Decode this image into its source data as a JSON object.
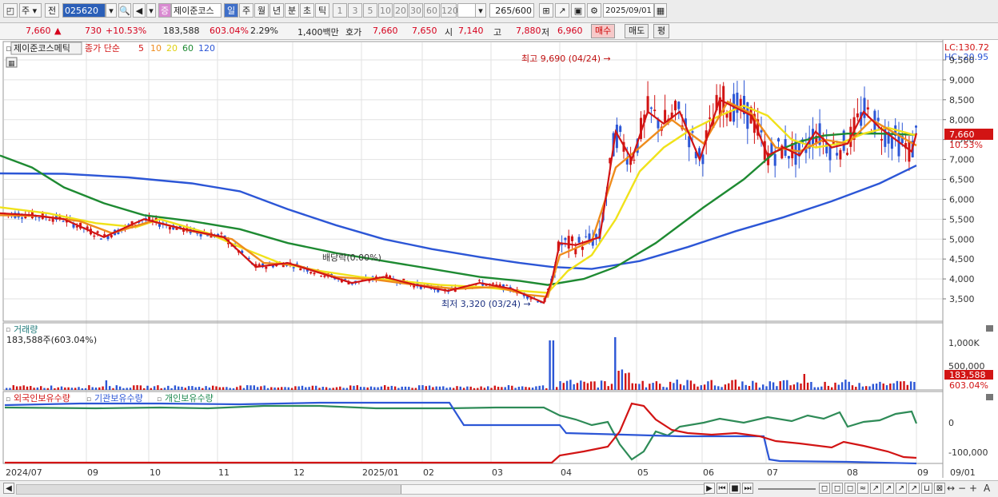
{
  "toolbar": {
    "type_label": "주",
    "jeon_label": "전",
    "code": "025620",
    "badge": "증",
    "stock_name": "제이준코스",
    "periods": [
      "일",
      "주",
      "월",
      "년",
      "분",
      "초",
      "틱"
    ],
    "active_period": "일",
    "minutes": [
      "1",
      "3",
      "5",
      "10",
      "20",
      "30",
      "60",
      "120"
    ],
    "count": "265",
    "count_total": "/600",
    "date": "2025/09/01"
  },
  "quote": {
    "price": "7,660",
    "up_arrow": "▲",
    "change": "730",
    "change_pct": "+10.53%",
    "volume": "183,588",
    "volume_ratio": "603.04%",
    "turnover_pct": "2.29%",
    "amount": "1,400백만",
    "hoga_label": "호가",
    "hoga_price": "7,660",
    "hoga2": "7,650",
    "open_label": "시",
    "open": "7,140",
    "high_label": "고",
    "high": "7,880",
    "low_label": "저",
    "low": "6,960",
    "buy_label": "매수",
    "sell_label": "매도",
    "eval_label": "평"
  },
  "price_panel": {
    "title": "제이준코스메틱",
    "ma_label": "종가 단순",
    "ma_periods": [
      "5",
      "10",
      "20",
      "60",
      "120"
    ],
    "ma_colors": [
      "#d21414",
      "#ef8c1c",
      "#f0e21a",
      "#1e8a32",
      "#2c56d6"
    ],
    "lc": "LC:130.72",
    "hc": "HC:-20.95",
    "y_ticks": [
      "9,500",
      "9,000",
      "8,500",
      "8,000",
      "7,500",
      "7,000",
      "6,500",
      "6,000",
      "5,500",
      "5,000",
      "4,500",
      "4,000",
      "3,500"
    ],
    "current_price": "7,660",
    "current_pct": "10.53%",
    "high_note": "최고 9,690 (04/24) →",
    "low_note": "최저 3,320 (03/24) →",
    "dividend_note": "배당락(0.00%)"
  },
  "volume_panel": {
    "title": "거래량",
    "value": "183,588주(603.04%)",
    "y_ticks": [
      "1,000K",
      "500,000"
    ],
    "current": "183,588",
    "current_pct": "603.04%"
  },
  "holding_panel": {
    "legend": [
      "외국인보유수량",
      "기관보유수량",
      "개인보유수량"
    ],
    "y_ticks": [
      "0",
      "-100,000"
    ]
  },
  "x_axis": {
    "labels": [
      "2024/07",
      "09",
      "10",
      "11",
      "12",
      "2025/01",
      "02",
      "03",
      "04",
      "05",
      "06",
      "07",
      "08",
      "09"
    ],
    "right_label": "09/01"
  },
  "chart_data": {
    "type": "line",
    "title": "제이준코스메틱",
    "x_axis_labels": [
      "2024/07",
      "09",
      "10",
      "11",
      "12",
      "2025/01",
      "02",
      "03",
      "04",
      "05",
      "06",
      "07",
      "08",
      "09"
    ],
    "y_range": [
      3200,
      9700
    ],
    "series": [
      {
        "name": "5",
        "points": [
          [
            0,
            5650
          ],
          [
            40,
            5600
          ],
          [
            80,
            5500
          ],
          [
            130,
            5050
          ],
          [
            180,
            5500
          ],
          [
            230,
            5250
          ],
          [
            280,
            5050
          ],
          [
            320,
            4300
          ],
          [
            360,
            4400
          ],
          [
            400,
            4150
          ],
          [
            440,
            3900
          ],
          [
            480,
            4050
          ],
          [
            520,
            3850
          ],
          [
            560,
            3700
          ],
          [
            600,
            3900
          ],
          [
            640,
            3750
          ],
          [
            680,
            3400
          ],
          [
            690,
            3950
          ],
          [
            700,
            4900
          ],
          [
            720,
            4850
          ],
          [
            750,
            5050
          ],
          [
            770,
            7700
          ],
          [
            790,
            7000
          ],
          [
            810,
            8200
          ],
          [
            830,
            7900
          ],
          [
            850,
            8200
          ],
          [
            875,
            7000
          ],
          [
            900,
            8500
          ],
          [
            920,
            8300
          ],
          [
            940,
            8100
          ],
          [
            960,
            7100
          ],
          [
            980,
            7300
          ],
          [
            1000,
            7100
          ],
          [
            1020,
            7700
          ],
          [
            1040,
            7300
          ],
          [
            1060,
            7400
          ],
          [
            1080,
            8200
          ],
          [
            1100,
            7800
          ],
          [
            1120,
            7500
          ],
          [
            1140,
            7200
          ],
          [
            1146,
            7660
          ]
        ]
      },
      {
        "name": "10",
        "points": [
          [
            0,
            5600
          ],
          [
            50,
            5580
          ],
          [
            100,
            5450
          ],
          [
            140,
            5150
          ],
          [
            190,
            5450
          ],
          [
            240,
            5200
          ],
          [
            290,
            5000
          ],
          [
            330,
            4400
          ],
          [
            370,
            4350
          ],
          [
            420,
            4050
          ],
          [
            470,
            3980
          ],
          [
            520,
            3850
          ],
          [
            570,
            3750
          ],
          [
            620,
            3800
          ],
          [
            660,
            3600
          ],
          [
            685,
            3550
          ],
          [
            700,
            4600
          ],
          [
            740,
            4950
          ],
          [
            770,
            6800
          ],
          [
            800,
            7300
          ],
          [
            840,
            8000
          ],
          [
            880,
            7400
          ],
          [
            910,
            8450
          ],
          [
            940,
            8150
          ],
          [
            970,
            7300
          ],
          [
            1000,
            7200
          ],
          [
            1030,
            7500
          ],
          [
            1060,
            7400
          ],
          [
            1090,
            8000
          ],
          [
            1120,
            7650
          ],
          [
            1146,
            7350
          ]
        ]
      },
      {
        "name": "20",
        "points": [
          [
            0,
            5800
          ],
          [
            60,
            5650
          ],
          [
            120,
            5400
          ],
          [
            170,
            5300
          ],
          [
            200,
            5500
          ],
          [
            260,
            5150
          ],
          [
            300,
            4800
          ],
          [
            350,
            4400
          ],
          [
            400,
            4200
          ],
          [
            450,
            4050
          ],
          [
            500,
            3950
          ],
          [
            550,
            3850
          ],
          [
            600,
            3800
          ],
          [
            650,
            3700
          ],
          [
            685,
            3650
          ],
          [
            710,
            4200
          ],
          [
            740,
            4600
          ],
          [
            770,
            5500
          ],
          [
            800,
            6700
          ],
          [
            830,
            7300
          ],
          [
            860,
            7700
          ],
          [
            900,
            8100
          ],
          [
            930,
            8350
          ],
          [
            960,
            8100
          ],
          [
            990,
            7500
          ],
          [
            1020,
            7300
          ],
          [
            1050,
            7400
          ],
          [
            1080,
            7650
          ],
          [
            1110,
            7800
          ],
          [
            1146,
            7600
          ]
        ]
      },
      {
        "name": "60",
        "points": [
          [
            0,
            7100
          ],
          [
            40,
            6800
          ],
          [
            80,
            6300
          ],
          [
            130,
            5900
          ],
          [
            180,
            5600
          ],
          [
            240,
            5450
          ],
          [
            300,
            5250
          ],
          [
            360,
            4900
          ],
          [
            420,
            4650
          ],
          [
            480,
            4450
          ],
          [
            540,
            4250
          ],
          [
            600,
            4050
          ],
          [
            650,
            3950
          ],
          [
            685,
            3850
          ],
          [
            730,
            4000
          ],
          [
            770,
            4300
          ],
          [
            820,
            4900
          ],
          [
            880,
            5800
          ],
          [
            930,
            6500
          ],
          [
            970,
            7200
          ],
          [
            1000,
            7450
          ],
          [
            1030,
            7600
          ],
          [
            1060,
            7650
          ],
          [
            1100,
            7650
          ],
          [
            1146,
            7620
          ]
        ]
      },
      {
        "name": "120",
        "points": [
          [
            0,
            6650
          ],
          [
            80,
            6640
          ],
          [
            160,
            6550
          ],
          [
            240,
            6400
          ],
          [
            300,
            6200
          ],
          [
            360,
            5750
          ],
          [
            420,
            5350
          ],
          [
            480,
            5000
          ],
          [
            540,
            4750
          ],
          [
            600,
            4550
          ],
          [
            650,
            4400
          ],
          [
            690,
            4300
          ],
          [
            740,
            4250
          ],
          [
            800,
            4450
          ],
          [
            860,
            4800
          ],
          [
            920,
            5200
          ],
          [
            980,
            5550
          ],
          [
            1040,
            5950
          ],
          [
            1100,
            6400
          ],
          [
            1146,
            6850
          ]
        ]
      }
    ]
  }
}
